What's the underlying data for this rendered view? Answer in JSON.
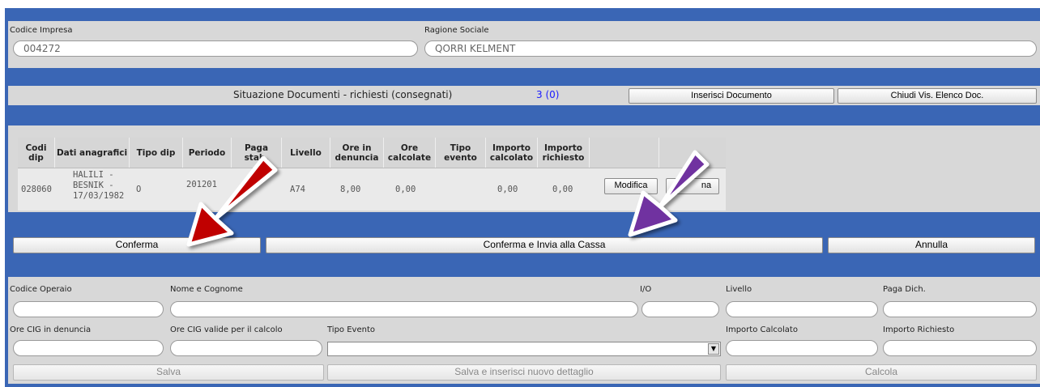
{
  "impresa": {
    "codice_label": "Codice Impresa",
    "codice_value": "004272",
    "ragione_label": "Ragione Sociale",
    "ragione_value": "QORRI KELMENT"
  },
  "documenti": {
    "situazione_label": "Situazione Documenti - richiesti (consegnati)",
    "count": "3 (0)",
    "inserisci_button": "Inserisci Documento",
    "chiudi_button": "Chiudi Vis. Elenco Doc."
  },
  "table": {
    "headers": [
      "Codi dip",
      "Dati anagrafici",
      "Tipo dip",
      "Periodo",
      "Paga stab.",
      "Livello",
      "Ore in denuncia",
      "Ore calcolate",
      "Tipo evento",
      "Importo calcolato",
      "Importo richiesto"
    ],
    "row": {
      "codi_dip": "028060",
      "anagrafici_1": "HALILI -",
      "anagrafici_2": "BESNIK -",
      "anagrafici_3": "17/03/1982",
      "tipo_dip": "O",
      "periodo": "201201",
      "livello": "A74",
      "ore_denuncia": "8,00",
      "ore_calcolate": "0,00",
      "importo_calcolato": "0,00",
      "importo_richiesto": "0,00",
      "modifica_button": "Modifica",
      "second_button": "na"
    }
  },
  "actions": {
    "conferma": "Conferma",
    "conferma_invia": "Conferma e Invia alla Cassa",
    "annulla": "Annulla"
  },
  "dettaglio": {
    "codice_operaio_label": "Codice Operaio",
    "nome_cognome_label": "Nome e Cognome",
    "io_label": "I/O",
    "livello_label": "Livello",
    "paga_dich_label": "Paga Dich.",
    "ore_cig_denuncia_label": "Ore CIG in denuncia",
    "ore_cig_valide_label": "Ore CIG valide per il calcolo",
    "tipo_evento_label": "Tipo Evento",
    "importo_calcolato_label": "Importo Calcolato",
    "importo_richiesto_label": "Importo Richiesto",
    "salva_button": "Salva",
    "salva_inserisci_button": "Salva e inserisci nuovo dettaglio",
    "calcola_button": "Calcola"
  },
  "colors": {
    "frame_blue": "#3a66b5",
    "band_grey": "#d8d8d8",
    "arrow_red": "#c00000",
    "arrow_purple": "#7030a0"
  }
}
